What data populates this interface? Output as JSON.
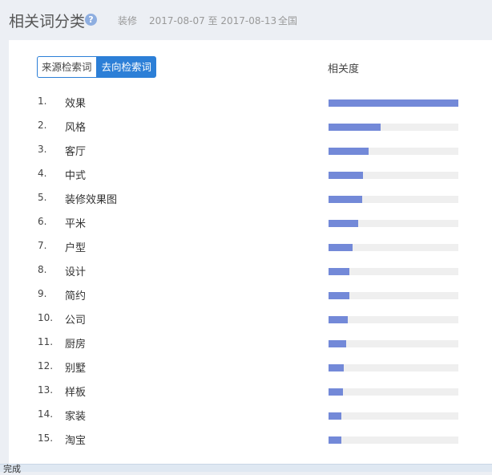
{
  "header": {
    "title": "相关词分类",
    "help_icon": "question-circle-icon",
    "category": "装修",
    "date_range": "2017-08-07 至 2017-08-13",
    "region": "全国"
  },
  "toggle": {
    "source_label": "来源检索词",
    "target_label": "去向检索词",
    "selected": "去向检索词"
  },
  "table": {
    "column_header": "相关度",
    "bar_color": "#7389d8",
    "track_color": "#efefef",
    "rows": [
      {
        "rank": "1.",
        "keyword": "效果",
        "relevance": 1.0
      },
      {
        "rank": "2.",
        "keyword": "风格",
        "relevance": 0.4
      },
      {
        "rank": "3.",
        "keyword": "客厅",
        "relevance": 0.31
      },
      {
        "rank": "4.",
        "keyword": "中式",
        "relevance": 0.265
      },
      {
        "rank": "5.",
        "keyword": "装修效果图",
        "relevance": 0.26
      },
      {
        "rank": "6.",
        "keyword": "平米",
        "relevance": 0.23
      },
      {
        "rank": "7.",
        "keyword": "户型",
        "relevance": 0.185
      },
      {
        "rank": "8.",
        "keyword": "设计",
        "relevance": 0.16
      },
      {
        "rank": "9.",
        "keyword": "简约",
        "relevance": 0.16
      },
      {
        "rank": "10.",
        "keyword": "公司",
        "relevance": 0.15
      },
      {
        "rank": "11.",
        "keyword": "厨房",
        "relevance": 0.135
      },
      {
        "rank": "12.",
        "keyword": "别墅",
        "relevance": 0.12
      },
      {
        "rank": "13.",
        "keyword": "样板",
        "relevance": 0.11
      },
      {
        "rank": "14.",
        "keyword": "家装",
        "relevance": 0.1
      },
      {
        "rank": "15.",
        "keyword": "淘宝",
        "relevance": 0.1
      }
    ]
  },
  "statusbar": {
    "text": "完成"
  }
}
